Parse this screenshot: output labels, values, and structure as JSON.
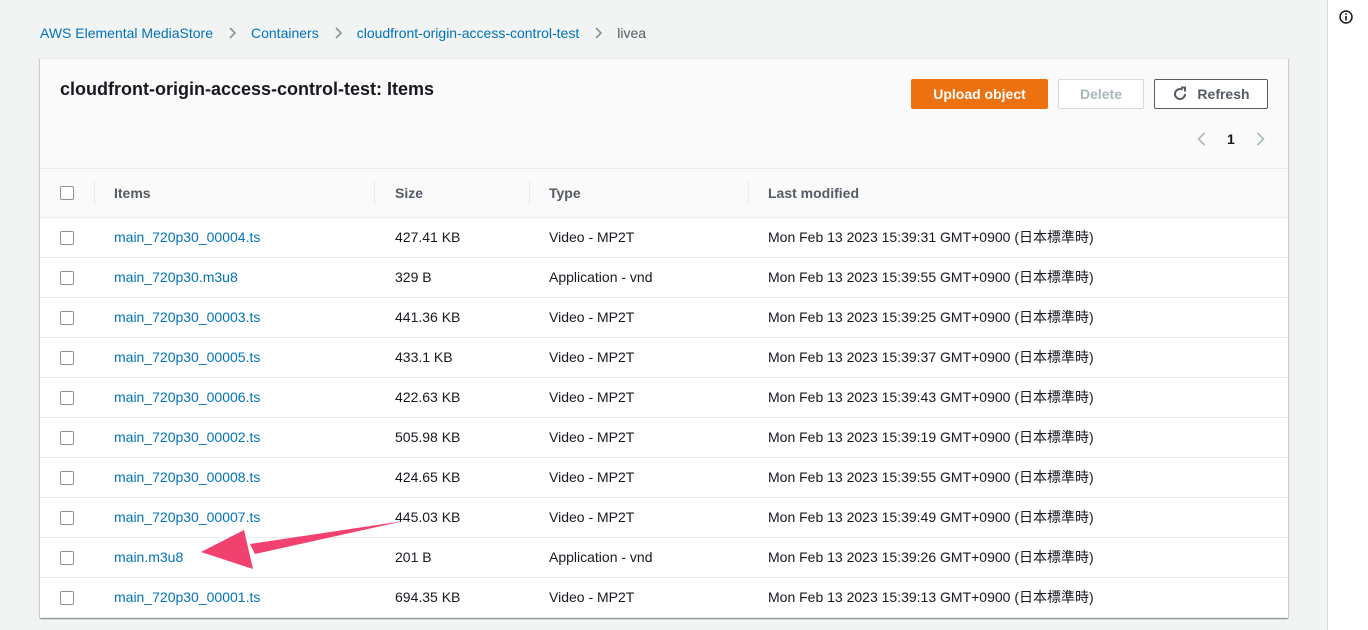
{
  "breadcrumb": {
    "items": [
      "AWS Elemental MediaStore",
      "Containers",
      "cloudfront-origin-access-control-test"
    ],
    "current": "livea"
  },
  "panel": {
    "title": "cloudfront-origin-access-control-test: Items",
    "upload_label": "Upload object",
    "delete_label": "Delete",
    "refresh_label": "Refresh",
    "page": "1"
  },
  "table": {
    "columns": [
      "Items",
      "Size",
      "Type",
      "Last modified"
    ],
    "rows": [
      {
        "name": "main_720p30_00004.ts",
        "size": "427.41 KB",
        "type": "Video - MP2T",
        "modified": "Mon Feb 13 2023 15:39:31 GMT+0900 (日本標準時)"
      },
      {
        "name": "main_720p30.m3u8",
        "size": "329 B",
        "type": "Application - vnd",
        "modified": "Mon Feb 13 2023 15:39:55 GMT+0900 (日本標準時)"
      },
      {
        "name": "main_720p30_00003.ts",
        "size": "441.36 KB",
        "type": "Video - MP2T",
        "modified": "Mon Feb 13 2023 15:39:25 GMT+0900 (日本標準時)"
      },
      {
        "name": "main_720p30_00005.ts",
        "size": "433.1 KB",
        "type": "Video - MP2T",
        "modified": "Mon Feb 13 2023 15:39:37 GMT+0900 (日本標準時)"
      },
      {
        "name": "main_720p30_00006.ts",
        "size": "422.63 KB",
        "type": "Video - MP2T",
        "modified": "Mon Feb 13 2023 15:39:43 GMT+0900 (日本標準時)"
      },
      {
        "name": "main_720p30_00002.ts",
        "size": "505.98 KB",
        "type": "Video - MP2T",
        "modified": "Mon Feb 13 2023 15:39:19 GMT+0900 (日本標準時)"
      },
      {
        "name": "main_720p30_00008.ts",
        "size": "424.65 KB",
        "type": "Video - MP2T",
        "modified": "Mon Feb 13 2023 15:39:55 GMT+0900 (日本標準時)"
      },
      {
        "name": "main_720p30_00007.ts",
        "size": "445.03 KB",
        "type": "Video - MP2T",
        "modified": "Mon Feb 13 2023 15:39:49 GMT+0900 (日本標準時)"
      },
      {
        "name": "main.m3u8",
        "size": "201 B",
        "type": "Application - vnd",
        "modified": "Mon Feb 13 2023 15:39:26 GMT+0900 (日本標準時)"
      },
      {
        "name": "main_720p30_00001.ts",
        "size": "694.35 KB",
        "type": "Video - MP2T",
        "modified": "Mon Feb 13 2023 15:39:13 GMT+0900 (日本標準時)"
      }
    ]
  },
  "colors": {
    "accent": "#ec7211",
    "link": "#0073bb",
    "annotation_arrow": "#f1416f"
  },
  "icons": {
    "breadcrumb_separator": "chevron-right-icon",
    "refresh": "refresh-icon",
    "page_prev": "chevron-left-icon",
    "page_next": "chevron-right-icon",
    "info": "info-icon",
    "annotation": "pink-arrow"
  }
}
